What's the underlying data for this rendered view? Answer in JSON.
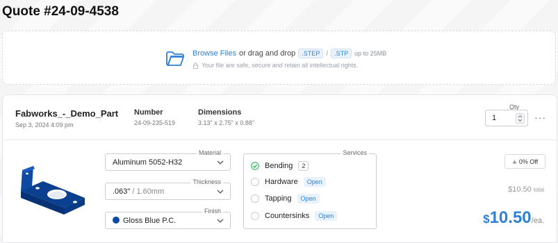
{
  "quote": {
    "title": "Quote #24-09-4538"
  },
  "upload": {
    "browse_label": "Browse Files",
    "or_text": "or drag and drop",
    "ext1": ".STEP",
    "ext_sep": "/",
    "ext2": ".STP",
    "limit": "up to 25MB",
    "security_note": "Your file are safe, secure and retain all intellectual rights.",
    "icon": "folder-icon",
    "accent": "#2f80d6"
  },
  "part": {
    "name": "Fabworks_-_Demo_Part",
    "date": "Sep 3, 2024 4:09 pm",
    "number_label": "Number",
    "number": "24-09-235-519",
    "dimensions_label": "Dimensions",
    "dimensions": "3.13\" x 2.75\" x 0.88\"",
    "qty_label": "Qty",
    "qty": "1",
    "more_label": "···",
    "image_color": "#0d4aa3"
  },
  "material": {
    "legend": "Material",
    "value": "Aluminum 5052-H32"
  },
  "thickness": {
    "legend": "Thickness",
    "value": ".063\"",
    "value_secondary": "/ 1.60mm"
  },
  "finish": {
    "legend": "Finish",
    "value": "Gloss Blue P.C.",
    "swatch": "#0d4aa3"
  },
  "services": {
    "legend": "Services",
    "items": [
      {
        "label": "Bending",
        "state": "checked",
        "badge": "2"
      },
      {
        "label": "Hardware",
        "state": "open",
        "badge": "Open"
      },
      {
        "label": "Tapping",
        "state": "open",
        "badge": "Open"
      },
      {
        "label": "Countersinks",
        "state": "open",
        "badge": "Open"
      }
    ]
  },
  "pricing": {
    "discount": "0% Off",
    "subtotal": "$10.50",
    "subtotal_unit": "total",
    "currency": "$",
    "price": "10.50",
    "per_unit": "/ea.",
    "accent": "#2f80d6"
  }
}
